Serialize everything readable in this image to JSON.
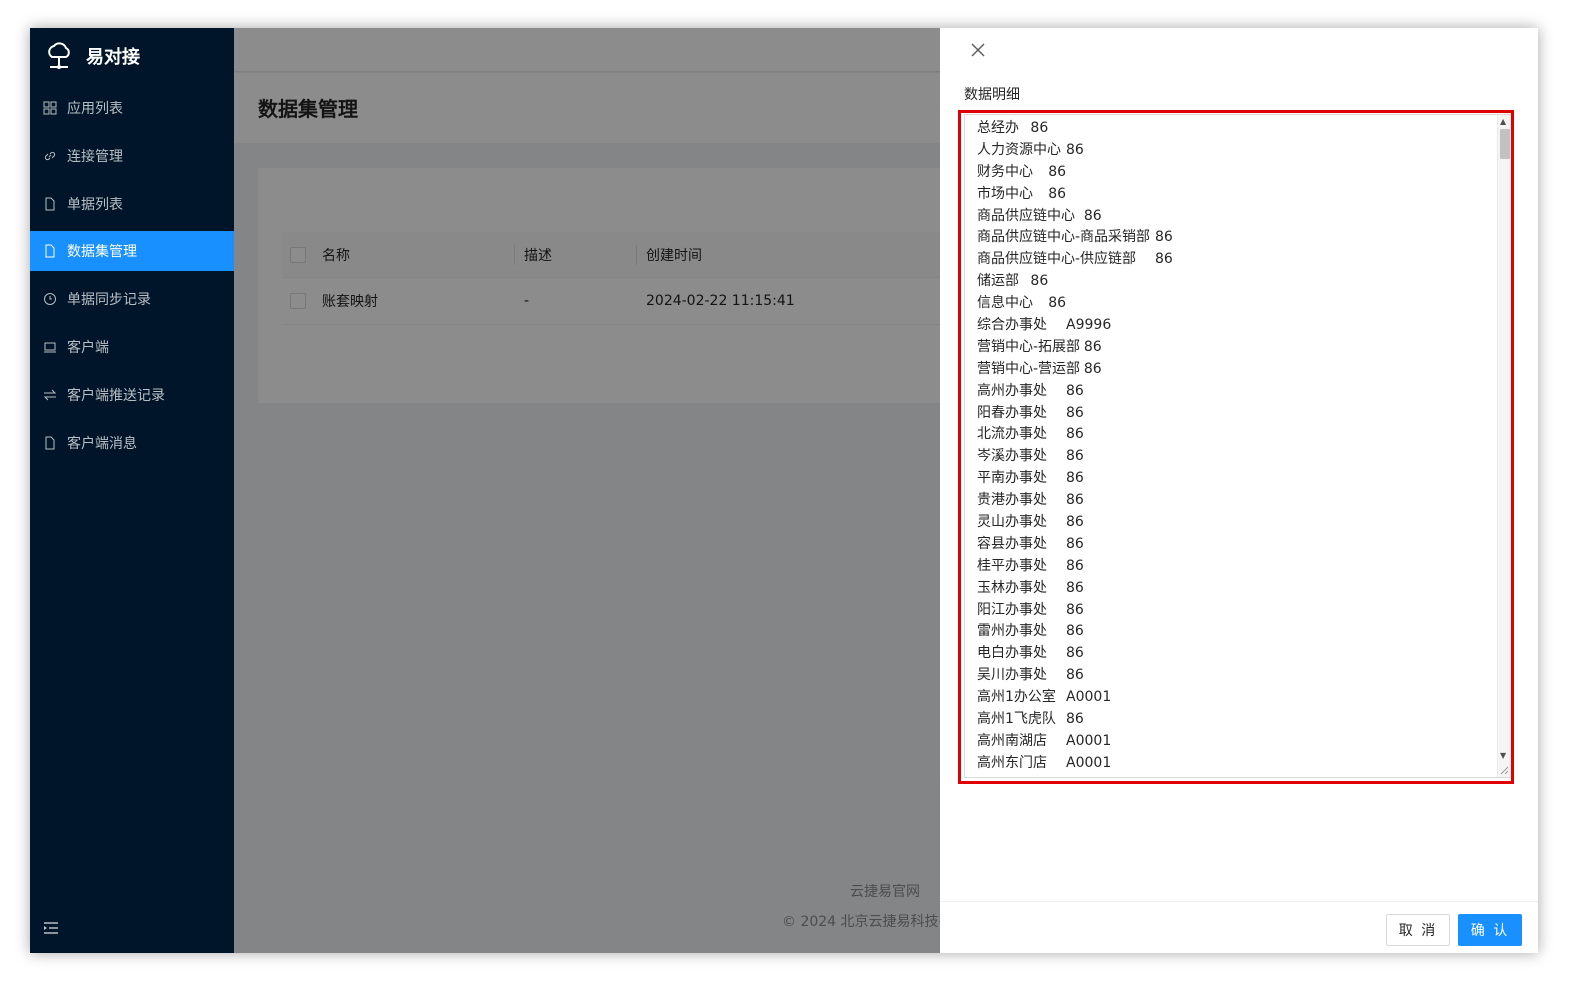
{
  "app": {
    "name": "易对接"
  },
  "sidebar": {
    "items": [
      {
        "label": "应用列表",
        "icon": "grid-icon"
      },
      {
        "label": "连接管理",
        "icon": "link-icon"
      },
      {
        "label": "单据列表",
        "icon": "file-icon"
      },
      {
        "label": "数据集管理",
        "icon": "file-icon",
        "active": true
      },
      {
        "label": "单据同步记录",
        "icon": "clock-icon"
      },
      {
        "label": "客户端",
        "icon": "laptop-icon"
      },
      {
        "label": "客户端推送记录",
        "icon": "swap-icon"
      },
      {
        "label": "客户端消息",
        "icon": "file-icon"
      }
    ],
    "collapse_icon": "menu-fold-icon"
  },
  "page": {
    "title": "数据集管理"
  },
  "table": {
    "columns": [
      "名称",
      "描述",
      "创建时间"
    ],
    "rows": [
      {
        "name": "账套映射",
        "description": "-",
        "created": "2024-02-22 11:15:41"
      }
    ]
  },
  "footer": {
    "link": "云捷易官网",
    "copyright": "© 2024 北京云捷易科技有"
  },
  "drawer": {
    "field_label": "数据明细",
    "lines": [
      "总经办\t86",
      "人力资源中心\t86",
      "财务中心\t86",
      "市场中心\t86",
      "商品供应链中心\t86",
      "商品供应链中心-商品采销部\t86",
      "商品供应链中心-供应链部\t86",
      "储运部\t86",
      "信息中心\t86",
      "综合办事处\tA9996",
      "营销中心-拓展部\t86",
      "营销中心-营运部\t86",
      "高州办事处\t86",
      "阳春办事处\t86",
      "北流办事处\t86",
      "岑溪办事处\t86",
      "平南办事处\t86",
      "贵港办事处\t86",
      "灵山办事处\t86",
      "容县办事处\t86",
      "桂平办事处\t86",
      "玉林办事处\t86",
      "阳江办事处\t86",
      "雷州办事处\t86",
      "电白办事处\t86",
      "吴川办事处\t86",
      "高州1办公室\tA0001",
      "高州1飞虎队\t86",
      "高州南湖店\tA0001",
      "高州东门店\tA0001"
    ],
    "cancel_label": "取 消",
    "ok_label": "确 认"
  },
  "colors": {
    "primary": "#1890ff",
    "sidebar_bg": "#001529",
    "highlight": "#e00000"
  }
}
